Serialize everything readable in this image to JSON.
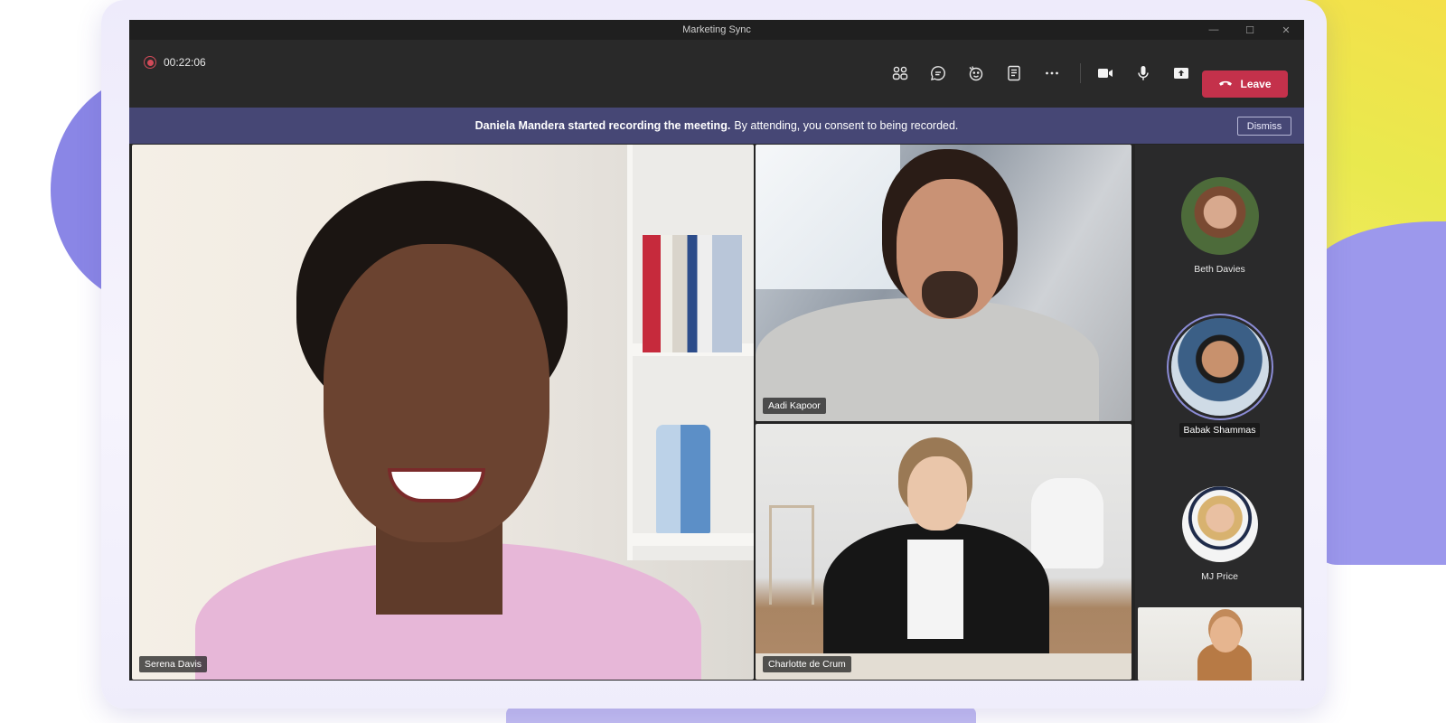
{
  "window": {
    "title": "Marketing Sync",
    "controls": [
      "—",
      "☐",
      "✕"
    ]
  },
  "toolbar": {
    "recording_time": "00:22:06",
    "icons": [
      "participants-icon",
      "chat-icon",
      "reactions-icon",
      "notes-icon",
      "more-icon",
      "camera-icon",
      "mic-icon",
      "share-icon"
    ],
    "leave_label": "Leave"
  },
  "banner": {
    "bold_text": "Daniela Mandera started recording the meeting.",
    "text": "By attending, you consent to being recorded.",
    "dismiss_label": "Dismiss"
  },
  "participants": {
    "main": {
      "name": "Serena Davis"
    },
    "top_right": {
      "name": "Aadi Kapoor"
    },
    "bottom_right": {
      "name": "Charlotte de Crum"
    }
  },
  "gallery": {
    "items": [
      {
        "name": "Beth Davies",
        "speaking": false
      },
      {
        "name": "Babak Shammas",
        "speaking": true
      },
      {
        "name": "MJ Price",
        "speaking": false
      }
    ]
  },
  "colors": {
    "leave_button": "#c4314b",
    "banner_bg": "#464775",
    "recording_red": "#d24b59",
    "speaking_ring": "#8b8cd6"
  }
}
